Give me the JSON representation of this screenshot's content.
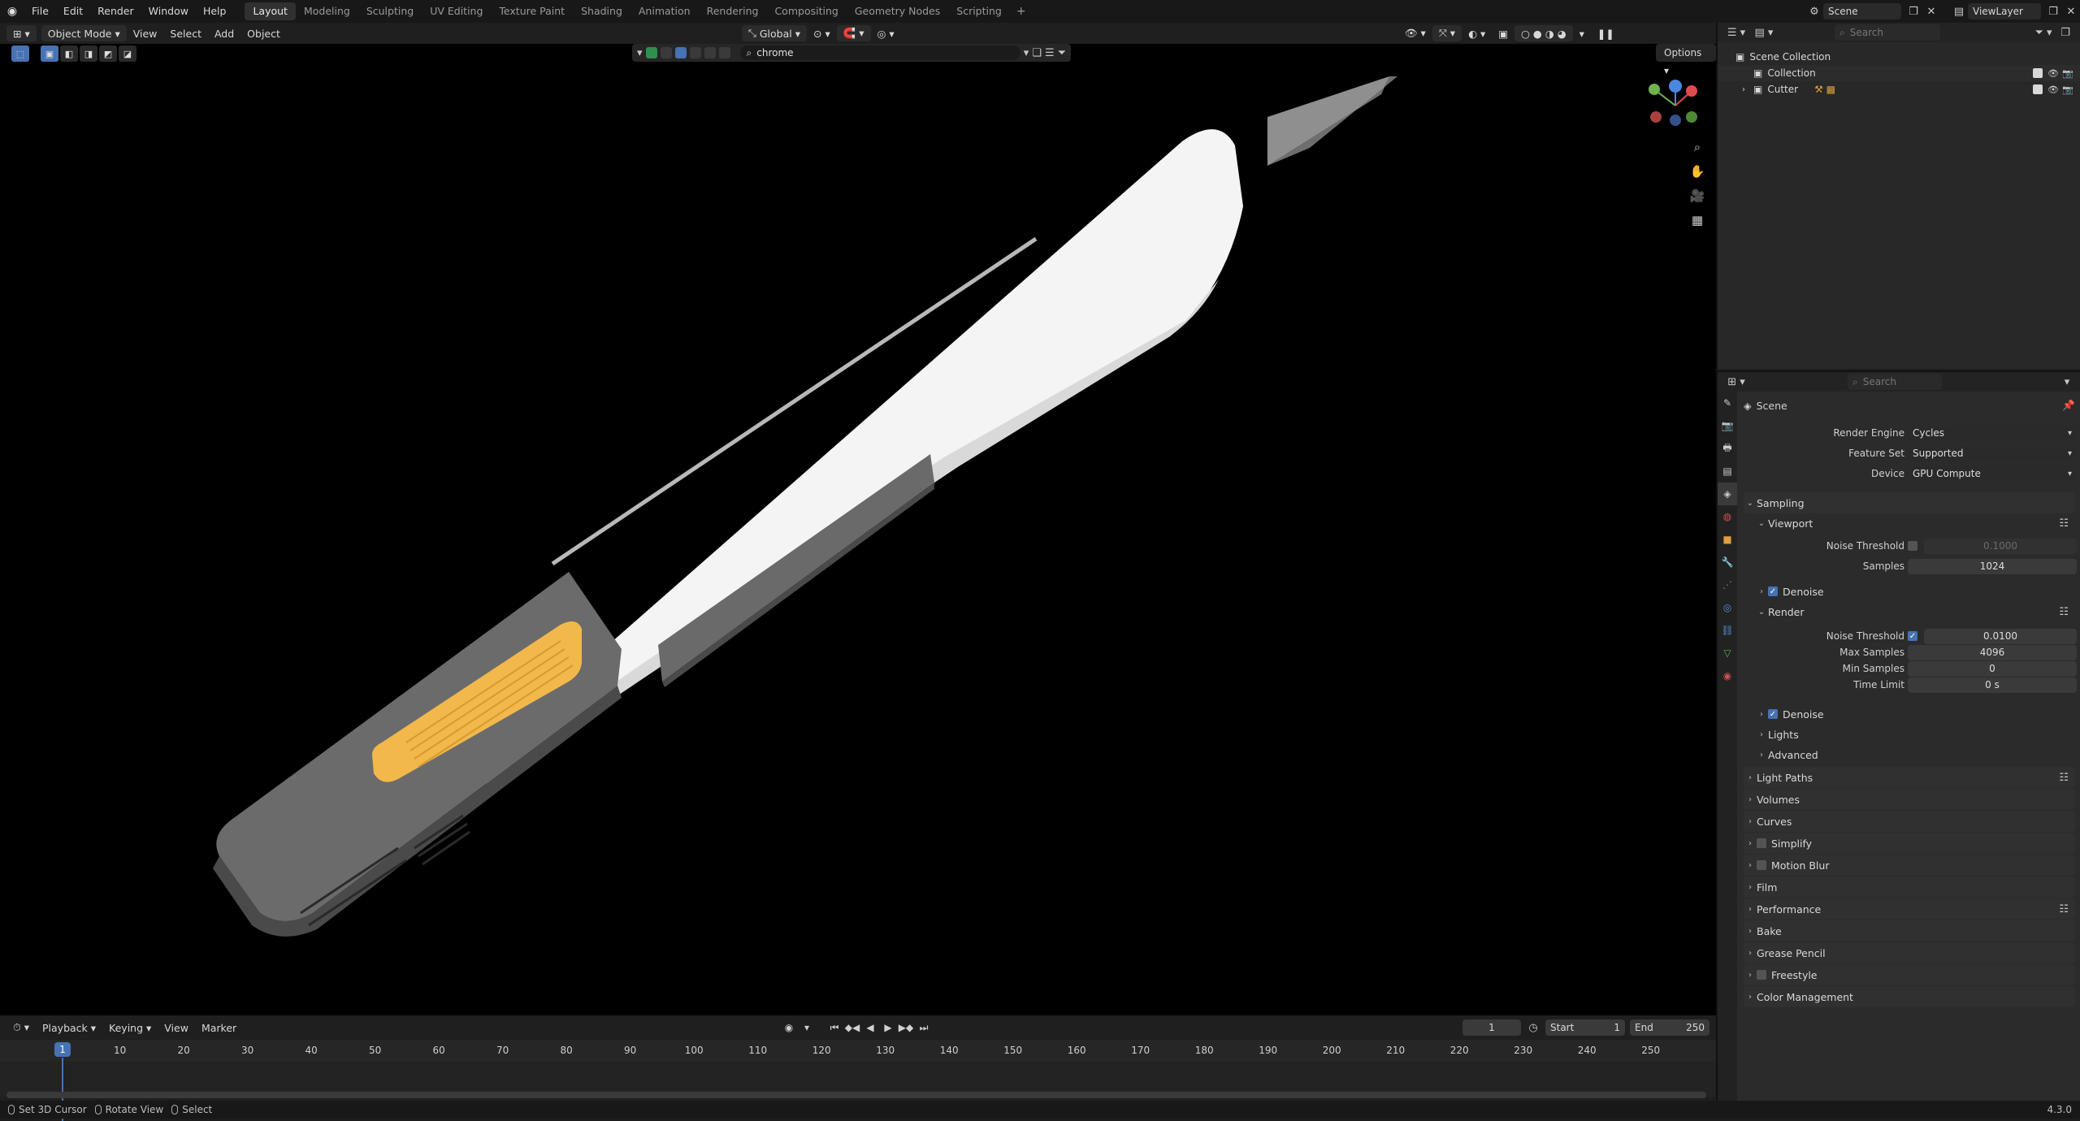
{
  "topbar": {
    "menu": [
      "File",
      "Edit",
      "Render",
      "Window",
      "Help"
    ],
    "workspaces": [
      "Layout",
      "Modeling",
      "Sculpting",
      "UV Editing",
      "Texture Paint",
      "Shading",
      "Animation",
      "Rendering",
      "Compositing",
      "Geometry Nodes",
      "Scripting"
    ],
    "active_workspace": "Layout",
    "scene": "Scene",
    "view_layer": "ViewLayer"
  },
  "viewport_header": {
    "mode": "Object Mode",
    "menu": [
      "View",
      "Select",
      "Add",
      "Object"
    ],
    "orientation": "Global",
    "options_label": "Options"
  },
  "filter": {
    "search_value": "chrome"
  },
  "outliner": {
    "search_placeholder": "Search",
    "items": [
      {
        "label": "Scene Collection"
      },
      {
        "label": "Collection"
      },
      {
        "label": "Cutter"
      }
    ]
  },
  "properties": {
    "search_placeholder": "Search",
    "context": "Scene",
    "render_engine_label": "Render Engine",
    "render_engine": "Cycles",
    "feature_set_label": "Feature Set",
    "feature_set": "Supported",
    "device_label": "Device",
    "device": "GPU Compute",
    "sampling": "Sampling",
    "viewport": "Viewport",
    "noise_threshold_label": "Noise Threshold",
    "viewport_noise_threshold": "0.1000",
    "samples_label": "Samples",
    "viewport_samples": "1024",
    "denoise": "Denoise",
    "render": "Render",
    "render_noise_threshold": "0.0100",
    "max_samples_label": "Max Samples",
    "max_samples": "4096",
    "min_samples_label": "Min Samples",
    "min_samples": "0",
    "time_limit_label": "Time Limit",
    "time_limit": "0 s",
    "lights": "Lights",
    "advanced": "Advanced",
    "panels": [
      "Light Paths",
      "Volumes",
      "Curves",
      "Simplify",
      "Motion Blur",
      "Film",
      "Performance",
      "Bake",
      "Grease Pencil",
      "Freestyle",
      "Color Management"
    ]
  },
  "timeline": {
    "menu": [
      "Playback",
      "Keying",
      "View",
      "Marker"
    ],
    "current_frame": "1",
    "start_label": "Start",
    "start": "1",
    "end_label": "End",
    "end": "250",
    "ticks": [
      "10",
      "20",
      "30",
      "40",
      "50",
      "60",
      "70",
      "80",
      "90",
      "100",
      "110",
      "120",
      "130",
      "140",
      "150",
      "160",
      "170",
      "180",
      "190",
      "200",
      "210",
      "220",
      "230",
      "240",
      "250"
    ]
  },
  "statusbar": {
    "items": [
      "Set 3D Cursor",
      "Rotate View",
      "Select"
    ],
    "version": "4.3.0"
  },
  "colors": {
    "accent": "#4772b3",
    "handle_yellow": "#f2b84b",
    "body_white": "#f4f4f4",
    "grey_cap": "#6b6b6b"
  }
}
